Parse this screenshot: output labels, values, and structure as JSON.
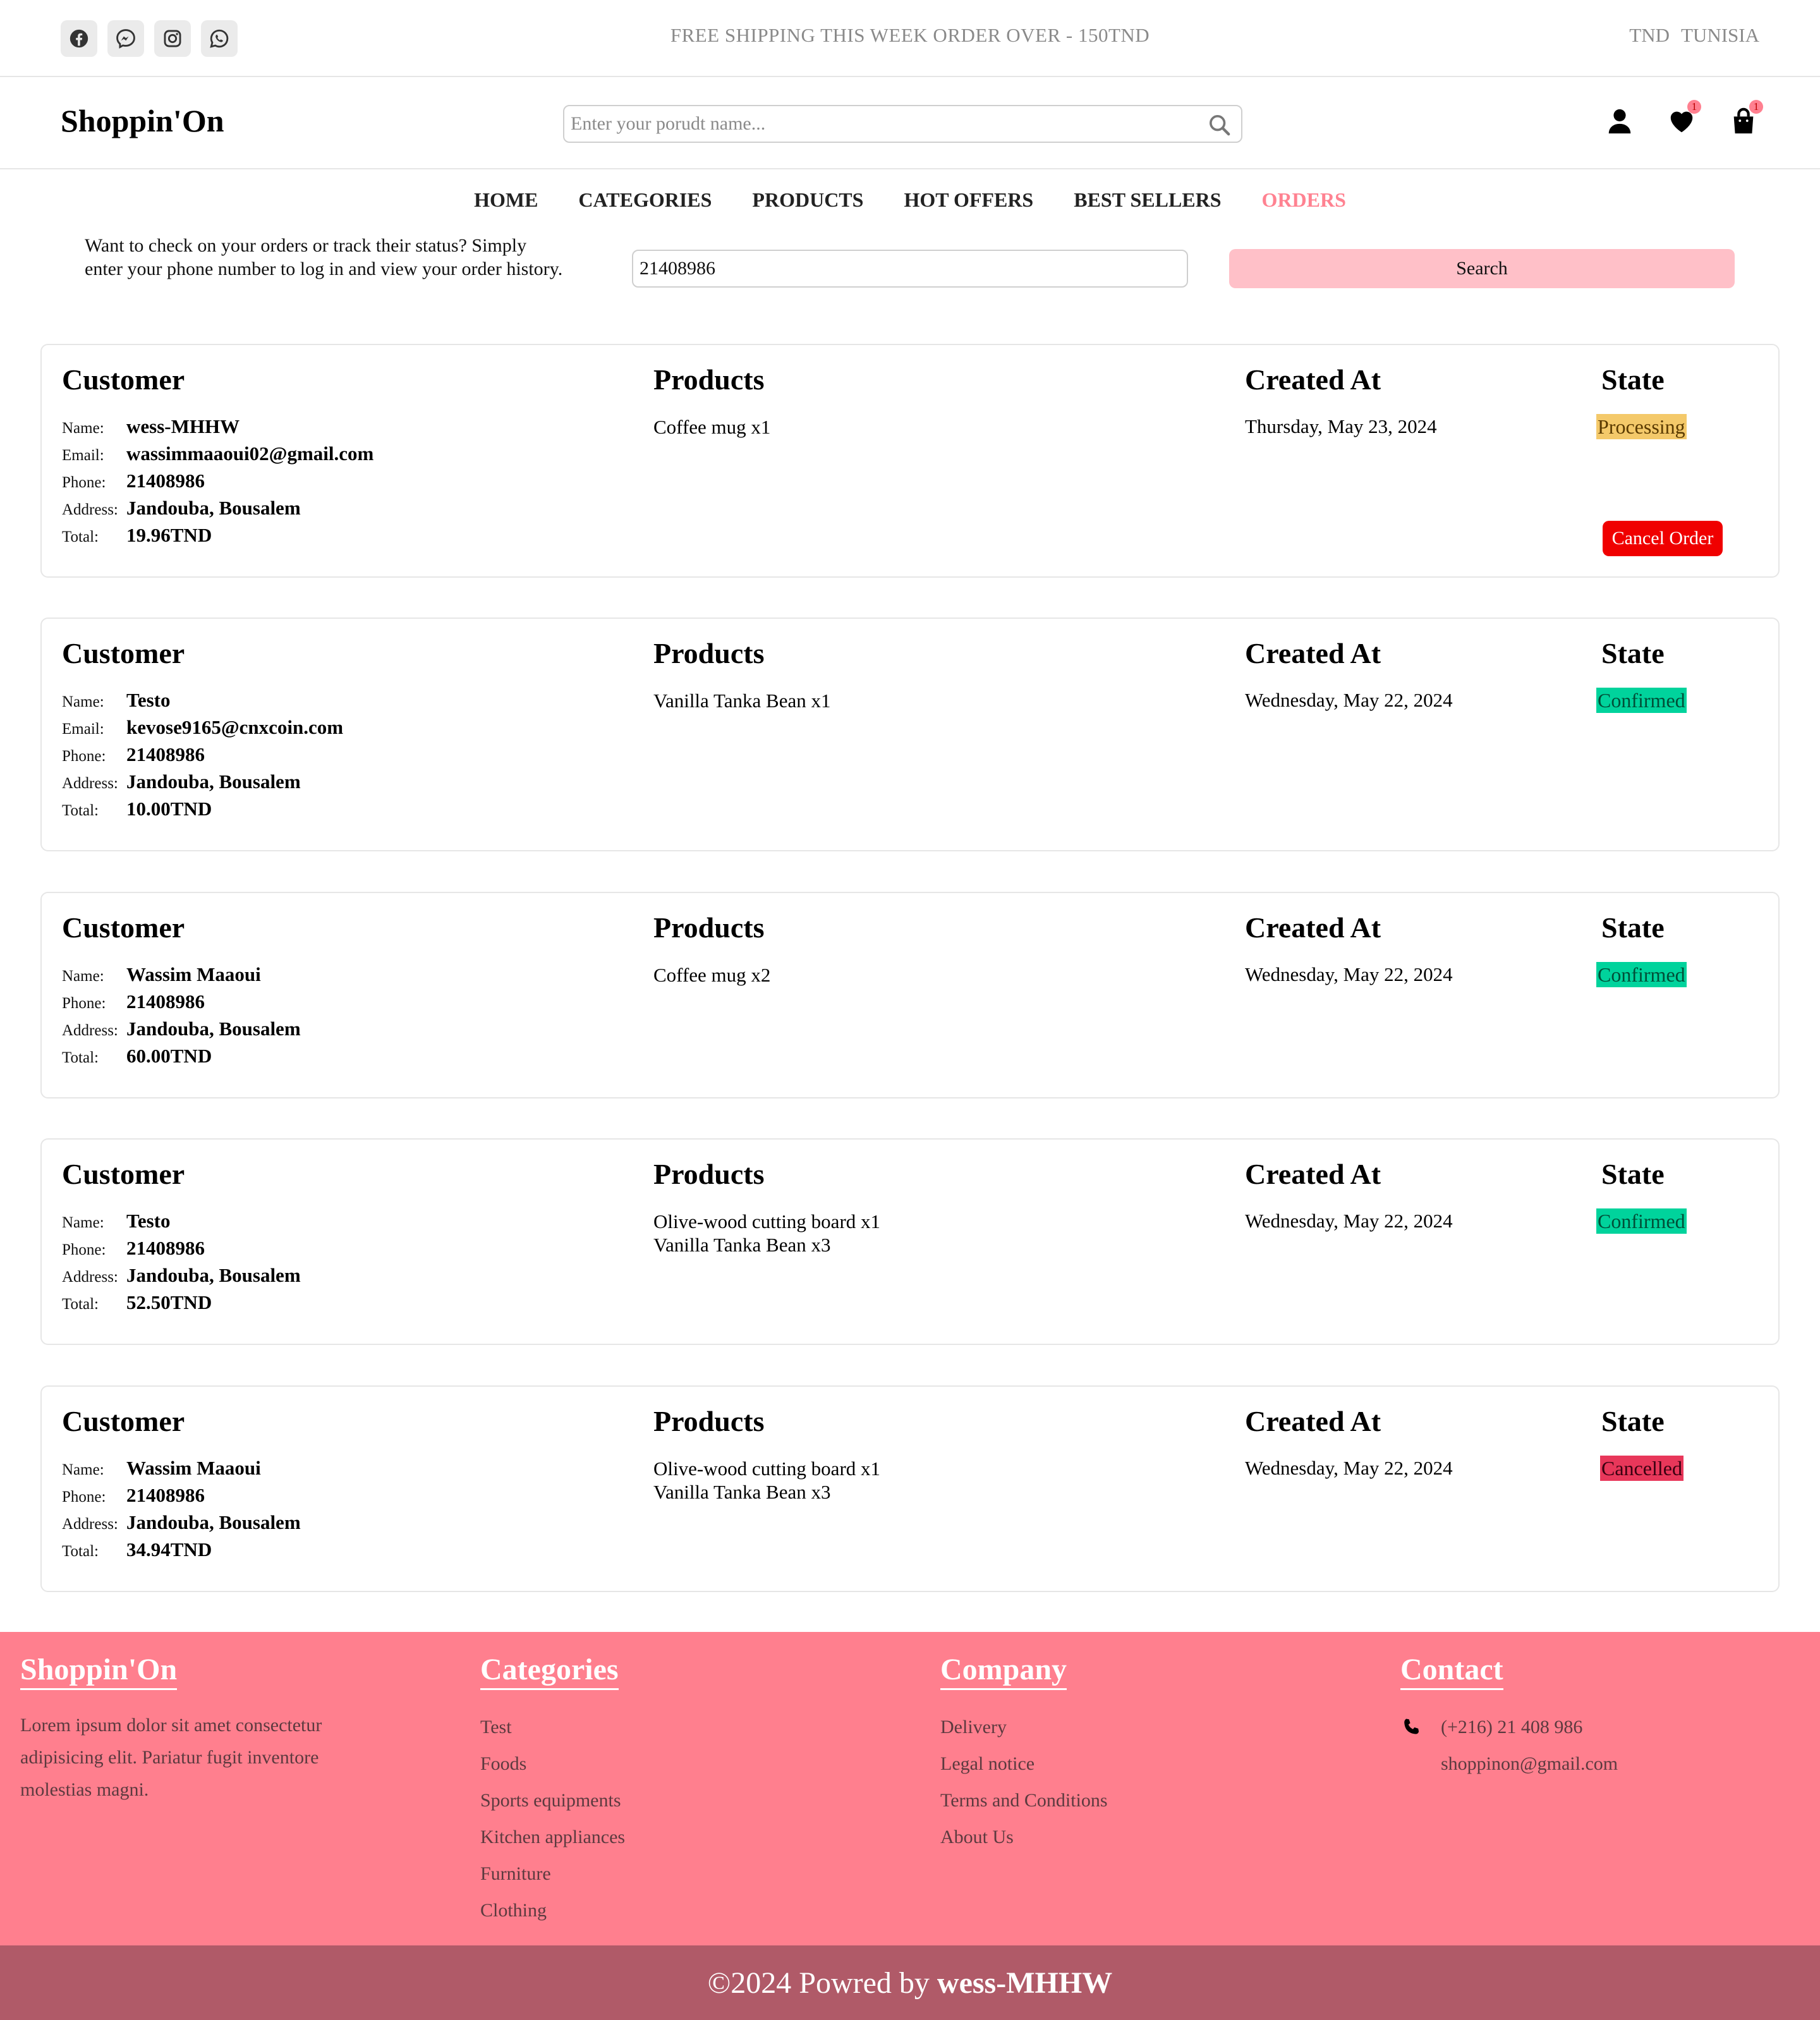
{
  "topbar": {
    "socials": [
      "facebook-icon",
      "messenger-icon",
      "instagram-icon",
      "whatsapp-icon"
    ],
    "promo": "FREE SHIPPING THIS WEEK ORDER OVER - 150TND",
    "currency": "TND",
    "country": "TUNISIA"
  },
  "header": {
    "logo": "Shoppin'On",
    "search_placeholder": "Enter your porudt name...",
    "wishlist_count": "1",
    "cart_count": "1"
  },
  "nav": [
    "HOME",
    "CATEGORIES",
    "PRODUCTS",
    "HOT OFFERS",
    "BEST SELLERS",
    "ORDERS"
  ],
  "lookup": {
    "text": "Want to check on your orders or track their status? Simply enter your phone number to log in and view your order history.",
    "phone_value": "21408986",
    "button": "Search"
  },
  "labels": {
    "customer": "Customer",
    "products": "Products",
    "created_at": "Created At",
    "state": "State",
    "name": "Name:",
    "email": "Email:",
    "phone": "Phone:",
    "address": "Address:",
    "total": "Total:",
    "cancel": "Cancel Order"
  },
  "orders": [
    {
      "name": "wess-MHHW",
      "email": "wassimmaaoui02@gmail.com",
      "phone": "21408986",
      "address": "Jandouba, Bousalem",
      "total": "19.96TND",
      "products": [
        "Coffee mug x1"
      ],
      "created": "Thursday, May 23, 2024",
      "state": "Processing"
    },
    {
      "name": "Testo",
      "email": "kevose9165@cnxcoin.com",
      "phone": "21408986",
      "address": "Jandouba, Bousalem",
      "total": "10.00TND",
      "products": [
        "Vanilla Tanka Bean x1"
      ],
      "created": "Wednesday, May 22, 2024",
      "state": "Confirmed"
    },
    {
      "name": "Wassim Maaoui",
      "phone": "21408986",
      "address": "Jandouba, Bousalem",
      "total": "60.00TND",
      "products": [
        "Coffee mug x2"
      ],
      "created": "Wednesday, May 22, 2024",
      "state": "Confirmed"
    },
    {
      "name": "Testo",
      "phone": "21408986",
      "address": "Jandouba, Bousalem",
      "total": "52.50TND",
      "products": [
        "Olive-wood cutting board x1",
        "Vanilla Tanka Bean x3"
      ],
      "created": "Wednesday, May 22, 2024",
      "state": "Confirmed"
    },
    {
      "name": "Wassim Maaoui",
      "phone": "21408986",
      "address": "Jandouba, Bousalem",
      "total": "34.94TND",
      "products": [
        "Olive-wood cutting board x1",
        "Vanilla Tanka Bean x3"
      ],
      "created": "Wednesday, May 22, 2024",
      "state": "Cancelled"
    }
  ],
  "footer": {
    "brand": "Shoppin'On",
    "description": "Lorem ipsum dolor sit amet consectetur adipisicing elit. Pariatur fugit inventore molestias magni.",
    "categories_title": "Categories",
    "categories": [
      "Test",
      "Foods",
      "Sports equipments",
      "Kitchen appliances",
      "Furniture",
      "Clothing"
    ],
    "company_title": "Company",
    "company": [
      "Delivery",
      "Legal notice",
      "Terms and Conditions",
      "About Us"
    ],
    "contact_title": "Contact",
    "phone": "(+216) 21 408 986",
    "email": "shoppinon@gmail.com",
    "copyright": "©2024 Powred by",
    "author": "wess-MHHW"
  },
  "colors": {
    "accent": "#ff8291",
    "footer_bg": "#ff7f8e",
    "bottombar_bg": "#b05a68",
    "processing": "#f4c96a",
    "confirmed": "#00d39c",
    "cancelled": "#e8375a",
    "cancel_button": "#f00000"
  }
}
